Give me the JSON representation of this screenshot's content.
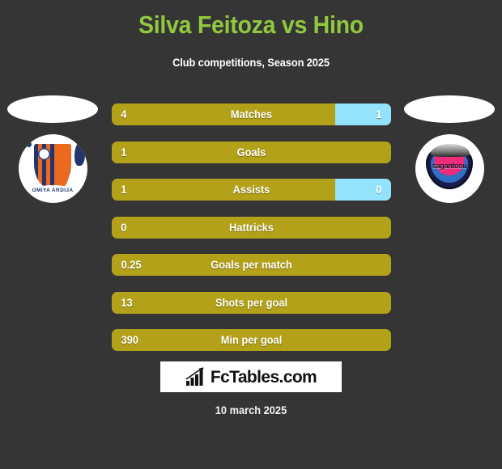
{
  "header": {
    "title": "Silva Feitoza vs Hino",
    "subtitle": "Club competitions, Season 2025",
    "title_color": "#92c83f"
  },
  "clubs": {
    "home": {
      "name": "OMIYA ARDIJA",
      "badge_icon": "omiya-ardija-crest-icon"
    },
    "away": {
      "name": "sagantosu",
      "badge_icon": "sagan-tosu-crest-icon"
    }
  },
  "colors": {
    "background": "#353535",
    "home_bar": "#b2a119",
    "away_bar": "#92e3fb",
    "value_text": "#ffffff"
  },
  "stats": [
    {
      "label": "Matches",
      "home": "4",
      "away": "1",
      "home_pct": 80,
      "away_pct": 20,
      "has_away": true
    },
    {
      "label": "Goals",
      "home": "1",
      "away": "",
      "home_pct": 100,
      "away_pct": 0,
      "has_away": false
    },
    {
      "label": "Assists",
      "home": "1",
      "away": "0",
      "home_pct": 80,
      "away_pct": 20,
      "has_away": true
    },
    {
      "label": "Hattricks",
      "home": "0",
      "away": "",
      "home_pct": 100,
      "away_pct": 0,
      "has_away": false
    },
    {
      "label": "Goals per match",
      "home": "0.25",
      "away": "",
      "home_pct": 100,
      "away_pct": 0,
      "has_away": false
    },
    {
      "label": "Shots per goal",
      "home": "13",
      "away": "",
      "home_pct": 100,
      "away_pct": 0,
      "has_away": false
    },
    {
      "label": "Min per goal",
      "home": "390",
      "away": "",
      "home_pct": 100,
      "away_pct": 0,
      "has_away": false
    }
  ],
  "footer": {
    "brand": "FcTables.com",
    "brand_icon": "bar-chart-growth-icon",
    "date": "10 march 2025"
  }
}
